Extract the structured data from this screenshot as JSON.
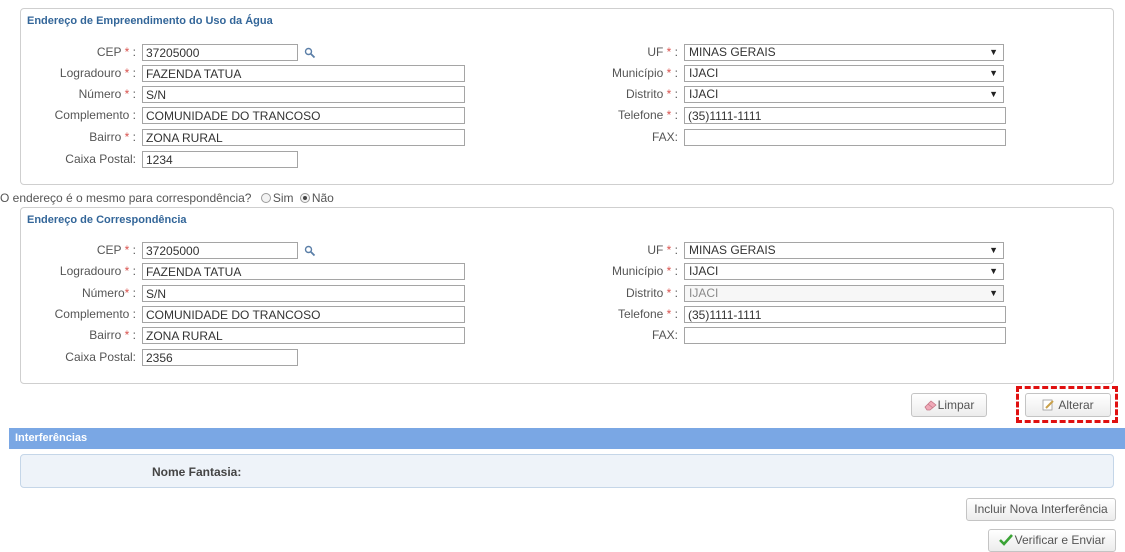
{
  "section1": {
    "title": "Endereço de Empreendimento do Uso da Água",
    "cep": {
      "label": "CEP",
      "value": "37205000"
    },
    "logradouro": {
      "label": "Logradouro",
      "value": "FAZENDA TATUA"
    },
    "numero": {
      "label": "Número",
      "value": "S/N"
    },
    "complemento": {
      "label": "Complemento",
      "value": "COMUNIDADE DO TRANCOSO"
    },
    "bairro": {
      "label": "Bairro",
      "value": "ZONA RURAL"
    },
    "caixa_postal": {
      "label": "Caixa Postal:",
      "value": "1234"
    },
    "uf": {
      "label": "UF",
      "value": "MINAS GERAIS"
    },
    "municipio": {
      "label": "Município",
      "value": "IJACI"
    },
    "distrito": {
      "label": "Distrito",
      "value": "IJACI"
    },
    "telefone": {
      "label": "Telefone",
      "value": "(35)1111-1111"
    },
    "fax": {
      "label": "FAX:",
      "value": ""
    }
  },
  "question": {
    "text": "O endereço é o mesmo para correspondência?",
    "option_sim": "Sim",
    "option_nao": "Não",
    "selected": "Não"
  },
  "section2": {
    "title": "Endereço de Correspondência",
    "cep": {
      "label": "CEP",
      "value": "37205000"
    },
    "logradouro": {
      "label": "Logradouro",
      "value": "FAZENDA TATUA"
    },
    "numero": {
      "label": "Número",
      "value": "S/N"
    },
    "complemento": {
      "label": "Complemento",
      "value": "COMUNIDADE DO TRANCOSO"
    },
    "bairro": {
      "label": "Bairro",
      "value": "ZONA RURAL"
    },
    "caixa_postal": {
      "label": "Caixa Postal:",
      "value": "2356"
    },
    "uf": {
      "label": "UF",
      "value": "MINAS GERAIS"
    },
    "municipio": {
      "label": "Município",
      "value": "IJACI"
    },
    "distrito": {
      "label": "Distrito",
      "value": "IJACI"
    },
    "telefone": {
      "label": "Telefone",
      "value": "(35)1111-1111"
    },
    "fax": {
      "label": "FAX:",
      "value": ""
    }
  },
  "buttons": {
    "limpar": "Limpar",
    "alterar": "Alterar",
    "incluir": "Incluir Nova Interferência",
    "verificar": "Verificar e Enviar"
  },
  "interferencias": {
    "title": "Interferências",
    "nome_fantasia_label": "Nome Fantasia:"
  },
  "colors": {
    "title_blue": "#336699",
    "section_bar": "#7aa7e4",
    "required": "#d9534f",
    "highlight": "#e01010",
    "check_green": "#3aa335"
  }
}
